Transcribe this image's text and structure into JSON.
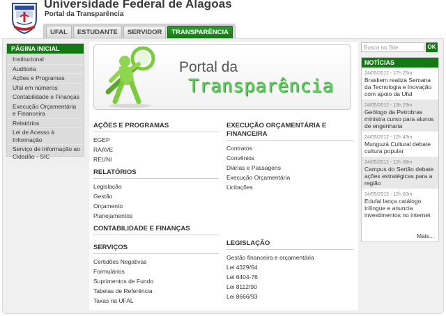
{
  "header": {
    "title": "Universidade Federal de Alagoas",
    "subtitle": "Portal da Transparência",
    "tabs": [
      {
        "label": "UFAL",
        "active": false
      },
      {
        "label": "ESTUDANTE",
        "active": false
      },
      {
        "label": "SERVIDOR",
        "active": false
      },
      {
        "label": "TRANSPARÊNCIA",
        "active": true
      }
    ]
  },
  "sidebar": {
    "title": "PÁGINA INICIAL",
    "items": [
      "Institucional",
      "Auditoria",
      "Ações e Programas",
      "Ufal em números",
      "Contabilidade e Finanças",
      "Execução Orçamentária e Financeira",
      "Relatórios",
      "Lei de Acesso à Informação",
      "Serviço de Informação ao Cidadão - SIC"
    ]
  },
  "banner": {
    "line1": "Portal da",
    "line2": "Transparência"
  },
  "sections": {
    "acoes": {
      "title": "AÇÕES E PROGRAMAS",
      "items": [
        "EGEP",
        "RAAVE",
        "REUNI"
      ]
    },
    "relatorios": {
      "title": "RELATÓRIOS",
      "items": [
        "Legislação",
        "Gestão",
        "Orçamento",
        "Planejamentos"
      ]
    },
    "contabilidade": {
      "title": "CONTABILIDADE E FINANÇAS",
      "items": []
    },
    "servicos": {
      "title": "SERVIÇOS",
      "items": [
        "Certidões Negativas",
        "Formulários",
        "Suprimentos de Fundo",
        "Tabelas de Referência",
        "Taxas na UFAL"
      ]
    },
    "execucao": {
      "title": "EXECUÇÃO ORÇAMENTÁRIA E FINANCEIRA",
      "items": [
        "Contratos",
        "Convênios",
        "Diárias e Passagens",
        "Execução Orçamentária",
        "Licitações"
      ]
    },
    "legislacao": {
      "title": "LEGISLAÇÃO",
      "items": [
        "Gestão financeira e orçamentária",
        "Lei 4329/64",
        "Lei 6404-76",
        "Lei 8112/90",
        "Lei 8666/93"
      ]
    }
  },
  "search": {
    "placeholder": "Busca no Site",
    "button": "OK"
  },
  "news": {
    "title": "NOTÍCIAS",
    "items": [
      {
        "date": "24/05/2012 - 17h 25m",
        "text": "Braskem realiza Semana da Tecnologia e Inovação com apoio da Ufal"
      },
      {
        "date": "24/05/2012 - 13h 29m",
        "text": "Geólogo da Petrobras ministra curso para alunos de engenharia"
      },
      {
        "date": "24/05/2012 - 12h 43m",
        "text": "Munguzá Cultural debate cultura popular"
      },
      {
        "date": "24/05/2012 - 12h 08m",
        "text": "Campus do Sertão debate ações estratégicas para a região"
      },
      {
        "date": "24/05/2012 - 12h 00m",
        "text": "Edufal lança catálogo trilíngue e anuncia investimentos no internet"
      }
    ],
    "more": "Mais..."
  },
  "colors": {
    "brand_green": "#137a13",
    "banner_text_green": "#5ad05a"
  }
}
